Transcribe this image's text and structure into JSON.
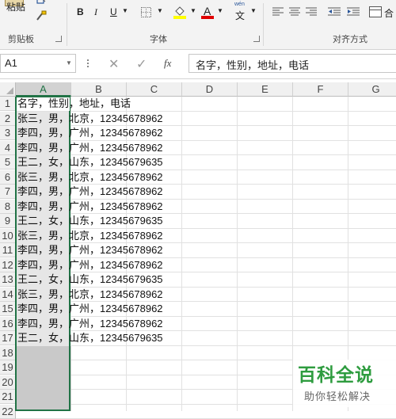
{
  "ribbon": {
    "paste_label": "粘贴",
    "clipboard_group": "剪贴板",
    "font_group": "字体",
    "align_group": "对齐方式",
    "bold": "B",
    "italic": "I",
    "underline": "U",
    "font_color_glyph": "A",
    "wen_glyph": "wén",
    "wen_char": "文",
    "colors": {
      "highlight": "#ffff00",
      "font_color": "#e00000"
    }
  },
  "formula_bar": {
    "name_box": "A1",
    "fx": "fx",
    "value": "名字，性别，地址，电话"
  },
  "columns": [
    "A",
    "B",
    "C",
    "D",
    "E",
    "F",
    "G"
  ],
  "rows": [
    "1",
    "2",
    "3",
    "4",
    "5",
    "6",
    "7",
    "8",
    "9",
    "10",
    "11",
    "12",
    "13",
    "14",
    "15",
    "16",
    "17",
    "18",
    "19",
    "20",
    "21",
    "22"
  ],
  "cells": [
    "名字，性别，地址，电话",
    "张三，男，北京，12345678962",
    "李四，男，广州，12345678962",
    "李四，男，广州，12345678962",
    "王二，女，山东，12345679635",
    "张三，男，北京，12345678962",
    "李四，男，广州，12345678962",
    "李四，男，广州，12345678962",
    "王二，女，山东，12345679635",
    "张三，男，北京，12345678962",
    "李四，男，广州，12345678962",
    "李四，男，广州，12345678962",
    "王二，女，山东，12345679635",
    "张三，男，北京，12345678962",
    "李四，男，广州，12345678962",
    "李四，男，广州，12345678962",
    "王二，女，山东，12345679635"
  ],
  "watermark": {
    "title": "百科全说",
    "subtitle": "助你轻松解决",
    "color": "#2e9c3f"
  },
  "selection_color": "#217346"
}
